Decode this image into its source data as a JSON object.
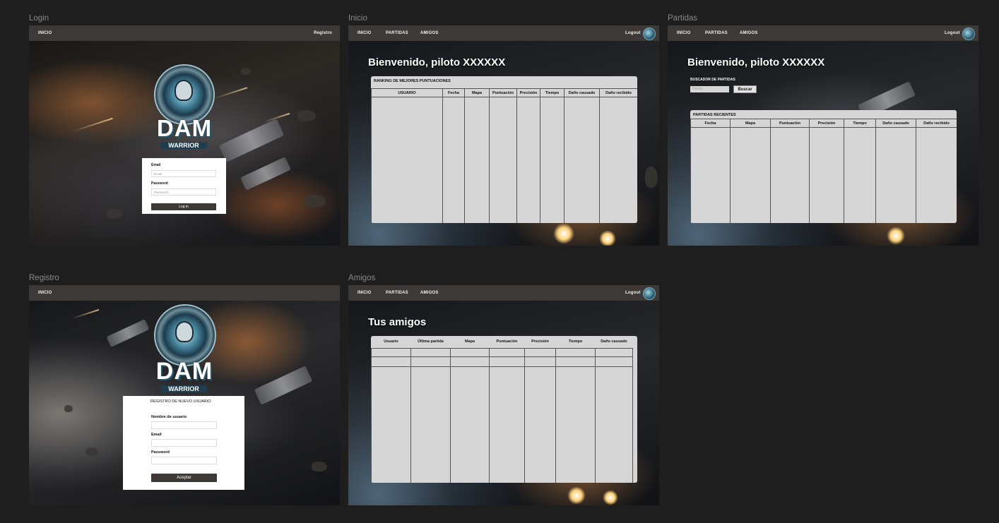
{
  "frames": {
    "login": {
      "label": "Login",
      "nav": {
        "inicio": "INICIO",
        "registro": "Registro"
      },
      "logo": {
        "title": "DAM",
        "subtitle": "WARRIOR"
      },
      "form": {
        "email_label": "Email",
        "email_placeholder": "Email",
        "password_label": "Password",
        "password_placeholder": "Password",
        "login_button": "Log in"
      }
    },
    "inicio": {
      "label": "Inicio",
      "nav": {
        "inicio": "INICIO",
        "partidas": "PARTIDAS",
        "amigos": "AMIGOS",
        "logout": "Logout"
      },
      "heading": "Bienvenido, piloto XXXXXX",
      "ranking": {
        "title": "RANKING DE MEJORES PUNTUACIONES",
        "columns": [
          "USUARIO",
          "Fecha",
          "Mapa",
          "Puntuación",
          "Precisión",
          "Tiempo",
          "Daño causado",
          "Daño recibido"
        ]
      }
    },
    "partidas": {
      "label": "Partidas",
      "nav": {
        "inicio": "INICIO",
        "partidas": "PARTIDAS",
        "amigos": "AMIGOS",
        "logout": "Logout"
      },
      "heading": "Bienvenido, piloto XXXXXX",
      "search": {
        "label": "BUSCADOR DE PARTIDAS",
        "placeholder": "Fecha",
        "button": "Buscar"
      },
      "recent": {
        "title": "PARTIDAS RECIENTES",
        "columns": [
          "Fecha",
          "Mapa",
          "Puntuación",
          "Precisión",
          "Tiempo",
          "Daño causado",
          "Daño recibido"
        ]
      }
    },
    "registro": {
      "label": "Registro",
      "nav": {
        "inicio": "INICIO"
      },
      "logo": {
        "title": "DAM",
        "subtitle": "WARRIOR"
      },
      "form": {
        "title": "REGISTRO DE NUEVO USUARIO",
        "username_label": "Nombre de usuario",
        "email_label": "Email",
        "password_label": "Password",
        "submit_button": "Aceptar"
      }
    },
    "amigos": {
      "label": "Amigos",
      "nav": {
        "inicio": "INICIO",
        "partidas": "PARTIDAS",
        "amigos": "AMIGOS",
        "logout": "Logout"
      },
      "heading": "Tus amigos",
      "friends": {
        "columns": [
          "Usuario",
          "Última partida",
          "Mapa",
          "Puntuación",
          "Precisión",
          "Tiempo",
          "Daño causado"
        ]
      }
    }
  },
  "colors": {
    "canvas": "#1e1e1e",
    "topbar": "#3d3937",
    "panel": "#d6d6d6",
    "label": "#8a8a8a"
  },
  "icons": [
    "avatar-icon"
  ]
}
